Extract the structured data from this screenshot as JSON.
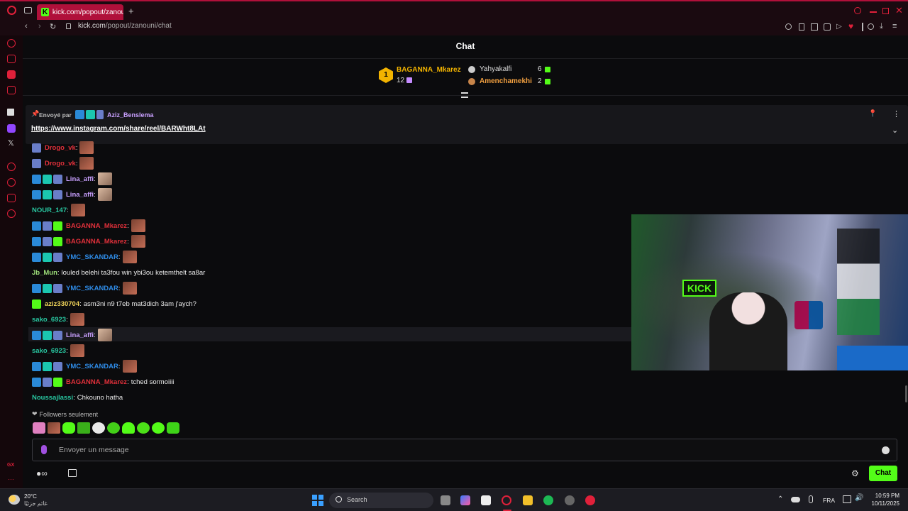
{
  "browser": {
    "tab_title": "kick.com/popout/zanouni",
    "new_tab_symbol": "+",
    "url_host": "kick.com",
    "url_path": "/popout/zanouni/chat"
  },
  "chat": {
    "title": "Chat",
    "leaderboard": {
      "first": {
        "rank": "1",
        "name": "BAGANNA_Mkarez",
        "count": "12"
      },
      "second": {
        "name": "Yahyakalfi",
        "count": "6"
      },
      "third": {
        "name": "Amenchamekhi",
        "count": "2"
      }
    },
    "pinned": {
      "sent_by_label": "Envoyé par",
      "author": "Aziz_Benslema",
      "link": "https://www.instagram.com/share/reel/BARWht8LAt"
    },
    "messages": [
      {
        "name": "Drogo_vk",
        "color": "#e0303a",
        "text": ""
      },
      {
        "name": "Drogo_vk",
        "color": "#e0303a",
        "text": ""
      },
      {
        "name": "Lina_affi",
        "color": "#c9a0ff",
        "text": ""
      },
      {
        "name": "Lina_affi",
        "color": "#c9a0ff",
        "text": ""
      },
      {
        "name": "NOUR_147",
        "color": "#28c6a0",
        "text": ""
      },
      {
        "name": "BAGANNA_Mkarez",
        "color": "#e0303a",
        "text": ""
      },
      {
        "name": "BAGANNA_Mkarez",
        "color": "#e0303a",
        "text": ""
      },
      {
        "name": "YMC_SKANDAR",
        "color": "#2f8ce8",
        "text": ""
      },
      {
        "name": "Jb_Mun",
        "color": "#9ee07a",
        "text": "louled belehi ta3fou win ybi3ou ketemthelt sa8ar"
      },
      {
        "name": "YMC_SKANDAR",
        "color": "#2f8ce8",
        "text": ""
      },
      {
        "name": "aziz330704",
        "color": "#f0d45a",
        "text": "asm3ni n9 t7eb mat3dich 3am j'aych?"
      },
      {
        "name": "sako_6923",
        "color": "#28c6a0",
        "text": ""
      },
      {
        "name": "Lina_affi",
        "color": "#c9a0ff",
        "text": ""
      },
      {
        "name": "sako_6923",
        "color": "#28c6a0",
        "text": ""
      },
      {
        "name": "YMC_SKANDAR",
        "color": "#2f8ce8",
        "text": ""
      },
      {
        "name": "BAGANNA_Mkarez",
        "color": "#e0303a",
        "text": "tched sormoiiii"
      },
      {
        "name": "Noussajlassi",
        "color": "#28c6a0",
        "text": "Chkouno hatha"
      }
    ],
    "followers_only": "Followers seulement",
    "input_placeholder": "Envoyer un message",
    "send_label": "Chat"
  },
  "taskbar": {
    "weather_temp": "20°C",
    "weather_desc": "غائم جزئيًا",
    "search_label": "Search",
    "lang": "FRA",
    "time": "10:59 PM",
    "date": "10/11/2025"
  },
  "colors": {
    "accent": "#53fc18",
    "browser_red": "#b0103a"
  }
}
